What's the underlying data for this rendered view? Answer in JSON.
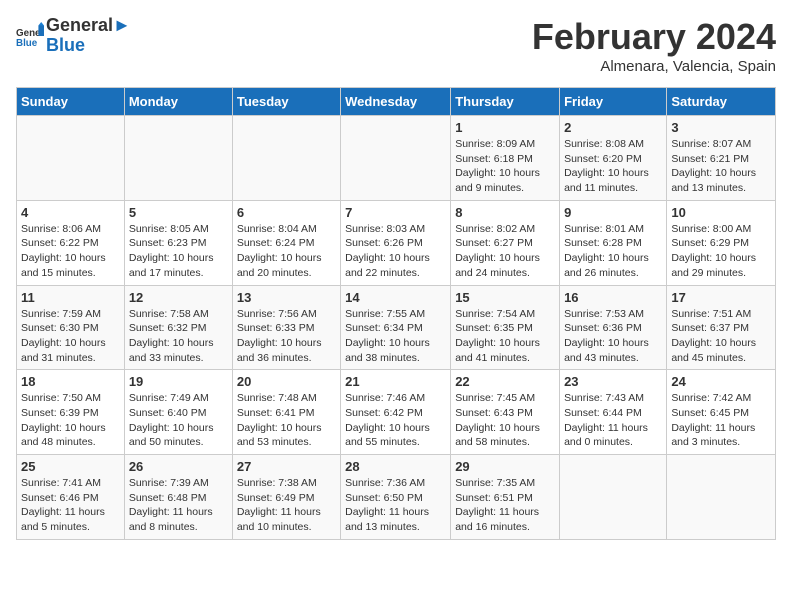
{
  "header": {
    "logo_line1": "General",
    "logo_line2": "Blue",
    "main_title": "February 2024",
    "subtitle": "Almenara, Valencia, Spain"
  },
  "days_of_week": [
    "Sunday",
    "Monday",
    "Tuesday",
    "Wednesday",
    "Thursday",
    "Friday",
    "Saturday"
  ],
  "weeks": [
    [
      {
        "day": "",
        "info": ""
      },
      {
        "day": "",
        "info": ""
      },
      {
        "day": "",
        "info": ""
      },
      {
        "day": "",
        "info": ""
      },
      {
        "day": "1",
        "info": "Sunrise: 8:09 AM\nSunset: 6:18 PM\nDaylight: 10 hours and 9 minutes."
      },
      {
        "day": "2",
        "info": "Sunrise: 8:08 AM\nSunset: 6:20 PM\nDaylight: 10 hours and 11 minutes."
      },
      {
        "day": "3",
        "info": "Sunrise: 8:07 AM\nSunset: 6:21 PM\nDaylight: 10 hours and 13 minutes."
      }
    ],
    [
      {
        "day": "4",
        "info": "Sunrise: 8:06 AM\nSunset: 6:22 PM\nDaylight: 10 hours and 15 minutes."
      },
      {
        "day": "5",
        "info": "Sunrise: 8:05 AM\nSunset: 6:23 PM\nDaylight: 10 hours and 17 minutes."
      },
      {
        "day": "6",
        "info": "Sunrise: 8:04 AM\nSunset: 6:24 PM\nDaylight: 10 hours and 20 minutes."
      },
      {
        "day": "7",
        "info": "Sunrise: 8:03 AM\nSunset: 6:26 PM\nDaylight: 10 hours and 22 minutes."
      },
      {
        "day": "8",
        "info": "Sunrise: 8:02 AM\nSunset: 6:27 PM\nDaylight: 10 hours and 24 minutes."
      },
      {
        "day": "9",
        "info": "Sunrise: 8:01 AM\nSunset: 6:28 PM\nDaylight: 10 hours and 26 minutes."
      },
      {
        "day": "10",
        "info": "Sunrise: 8:00 AM\nSunset: 6:29 PM\nDaylight: 10 hours and 29 minutes."
      }
    ],
    [
      {
        "day": "11",
        "info": "Sunrise: 7:59 AM\nSunset: 6:30 PM\nDaylight: 10 hours and 31 minutes."
      },
      {
        "day": "12",
        "info": "Sunrise: 7:58 AM\nSunset: 6:32 PM\nDaylight: 10 hours and 33 minutes."
      },
      {
        "day": "13",
        "info": "Sunrise: 7:56 AM\nSunset: 6:33 PM\nDaylight: 10 hours and 36 minutes."
      },
      {
        "day": "14",
        "info": "Sunrise: 7:55 AM\nSunset: 6:34 PM\nDaylight: 10 hours and 38 minutes."
      },
      {
        "day": "15",
        "info": "Sunrise: 7:54 AM\nSunset: 6:35 PM\nDaylight: 10 hours and 41 minutes."
      },
      {
        "day": "16",
        "info": "Sunrise: 7:53 AM\nSunset: 6:36 PM\nDaylight: 10 hours and 43 minutes."
      },
      {
        "day": "17",
        "info": "Sunrise: 7:51 AM\nSunset: 6:37 PM\nDaylight: 10 hours and 45 minutes."
      }
    ],
    [
      {
        "day": "18",
        "info": "Sunrise: 7:50 AM\nSunset: 6:39 PM\nDaylight: 10 hours and 48 minutes."
      },
      {
        "day": "19",
        "info": "Sunrise: 7:49 AM\nSunset: 6:40 PM\nDaylight: 10 hours and 50 minutes."
      },
      {
        "day": "20",
        "info": "Sunrise: 7:48 AM\nSunset: 6:41 PM\nDaylight: 10 hours and 53 minutes."
      },
      {
        "day": "21",
        "info": "Sunrise: 7:46 AM\nSunset: 6:42 PM\nDaylight: 10 hours and 55 minutes."
      },
      {
        "day": "22",
        "info": "Sunrise: 7:45 AM\nSunset: 6:43 PM\nDaylight: 10 hours and 58 minutes."
      },
      {
        "day": "23",
        "info": "Sunrise: 7:43 AM\nSunset: 6:44 PM\nDaylight: 11 hours and 0 minutes."
      },
      {
        "day": "24",
        "info": "Sunrise: 7:42 AM\nSunset: 6:45 PM\nDaylight: 11 hours and 3 minutes."
      }
    ],
    [
      {
        "day": "25",
        "info": "Sunrise: 7:41 AM\nSunset: 6:46 PM\nDaylight: 11 hours and 5 minutes."
      },
      {
        "day": "26",
        "info": "Sunrise: 7:39 AM\nSunset: 6:48 PM\nDaylight: 11 hours and 8 minutes."
      },
      {
        "day": "27",
        "info": "Sunrise: 7:38 AM\nSunset: 6:49 PM\nDaylight: 11 hours and 10 minutes."
      },
      {
        "day": "28",
        "info": "Sunrise: 7:36 AM\nSunset: 6:50 PM\nDaylight: 11 hours and 13 minutes."
      },
      {
        "day": "29",
        "info": "Sunrise: 7:35 AM\nSunset: 6:51 PM\nDaylight: 11 hours and 16 minutes."
      },
      {
        "day": "",
        "info": ""
      },
      {
        "day": "",
        "info": ""
      }
    ]
  ]
}
